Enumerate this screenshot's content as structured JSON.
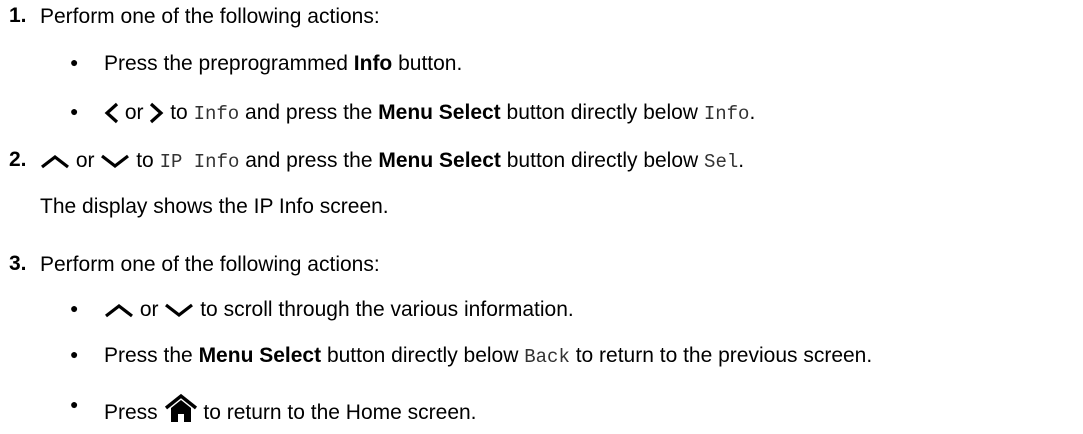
{
  "steps": [
    {
      "number": "1.",
      "text": "Perform one of the following actions:",
      "bullets": [
        {
          "pre": "Press the preprogrammed ",
          "bold": "Info",
          "post": " button."
        },
        {
          "or": "or",
          "to": "to",
          "mono1": "Info",
          "mid": "and press the",
          "bold": "Menu Select",
          "post": "button directly below",
          "mono2": "Info",
          "end": "."
        }
      ]
    },
    {
      "number": "2.",
      "or": "or",
      "to": "to",
      "mono1": "IP Info",
      "mid": "and press the",
      "bold": "Menu Select",
      "post": "button directly below",
      "mono2": "Sel",
      "end": ".",
      "note": "The display shows the IP Info screen."
    },
    {
      "number": "3.",
      "text": "Perform one of the following actions:",
      "bullets": [
        {
          "or": "or",
          "post": "to scroll through the various information."
        },
        {
          "pre": "Press the",
          "bold": "Menu Select",
          "mid": "button directly below",
          "mono": "Back",
          "post": "to return to the previous screen."
        },
        {
          "pre": "Press",
          "post": "to return to the Home screen."
        }
      ]
    }
  ],
  "bullet_symbol": "●",
  "icons": [
    "chevron-left-icon",
    "chevron-right-icon",
    "chevron-up-icon",
    "chevron-down-icon",
    "home-icon"
  ]
}
